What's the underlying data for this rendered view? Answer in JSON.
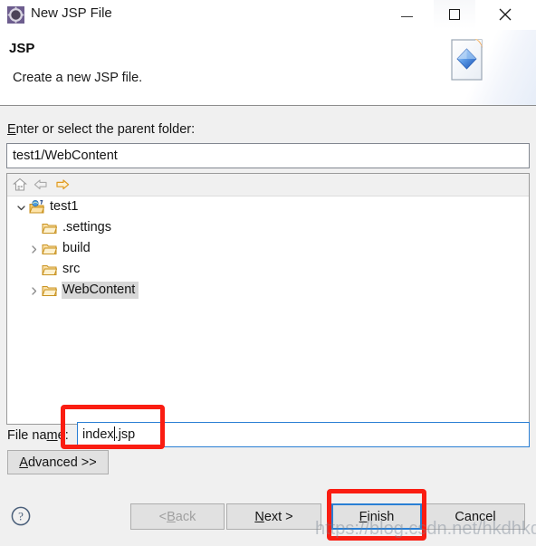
{
  "window": {
    "title": "New JSP File",
    "icon": "jsp-wizard-icon",
    "controls": {
      "minimize": "minimize-icon",
      "maximize": "maximize-icon",
      "close": "close-icon"
    }
  },
  "header": {
    "title": "JSP",
    "description": "Create a new JSP file.",
    "banner_icon": "jsp-file-banner-icon"
  },
  "parent_folder": {
    "label_prefix": "E",
    "label_rest": "nter or select the parent folder:",
    "value": "test1/WebContent",
    "placeholder": ""
  },
  "tree_toolbar": {
    "home": "home-icon",
    "back": "back-arrow-icon",
    "forward": "forward-arrow-icon"
  },
  "tree": {
    "items": [
      {
        "label": "test1",
        "indent": 0,
        "twisty": "expanded",
        "icon": "web-project-icon",
        "selected": false
      },
      {
        "label": ".settings",
        "indent": 1,
        "twisty": "none",
        "icon": "folder-icon",
        "selected": false
      },
      {
        "label": "build",
        "indent": 1,
        "twisty": "collapsed",
        "icon": "folder-icon",
        "selected": false
      },
      {
        "label": "src",
        "indent": 1,
        "twisty": "none",
        "icon": "folder-icon",
        "selected": false
      },
      {
        "label": "WebContent",
        "indent": 1,
        "twisty": "collapsed",
        "icon": "folder-icon",
        "selected": true
      }
    ]
  },
  "file_name": {
    "label_before": "File na",
    "label_mnemonic": "m",
    "label_after": "e:",
    "value_before_caret": "index",
    "value_after_caret": ".jsp",
    "placeholder": ""
  },
  "advanced": {
    "mnemonic": "A",
    "rest": "dvanced >>"
  },
  "footer": {
    "help": "help-icon",
    "back": {
      "prefix": "< ",
      "mnemonic": "B",
      "rest": "ack",
      "enabled": false
    },
    "next": {
      "mnemonic": "N",
      "rest": "ext >",
      "enabled": true
    },
    "finish": {
      "mnemonic": "F",
      "rest": "inish",
      "enabled": true,
      "focused": true
    },
    "cancel": {
      "label": "Cancel",
      "enabled": true
    }
  },
  "annotations": {
    "filename_box_color": "#fa1d12",
    "finish_box_color": "#fa1d12"
  },
  "watermark": "https://blog.csdn.net/hkdhkdhkd"
}
